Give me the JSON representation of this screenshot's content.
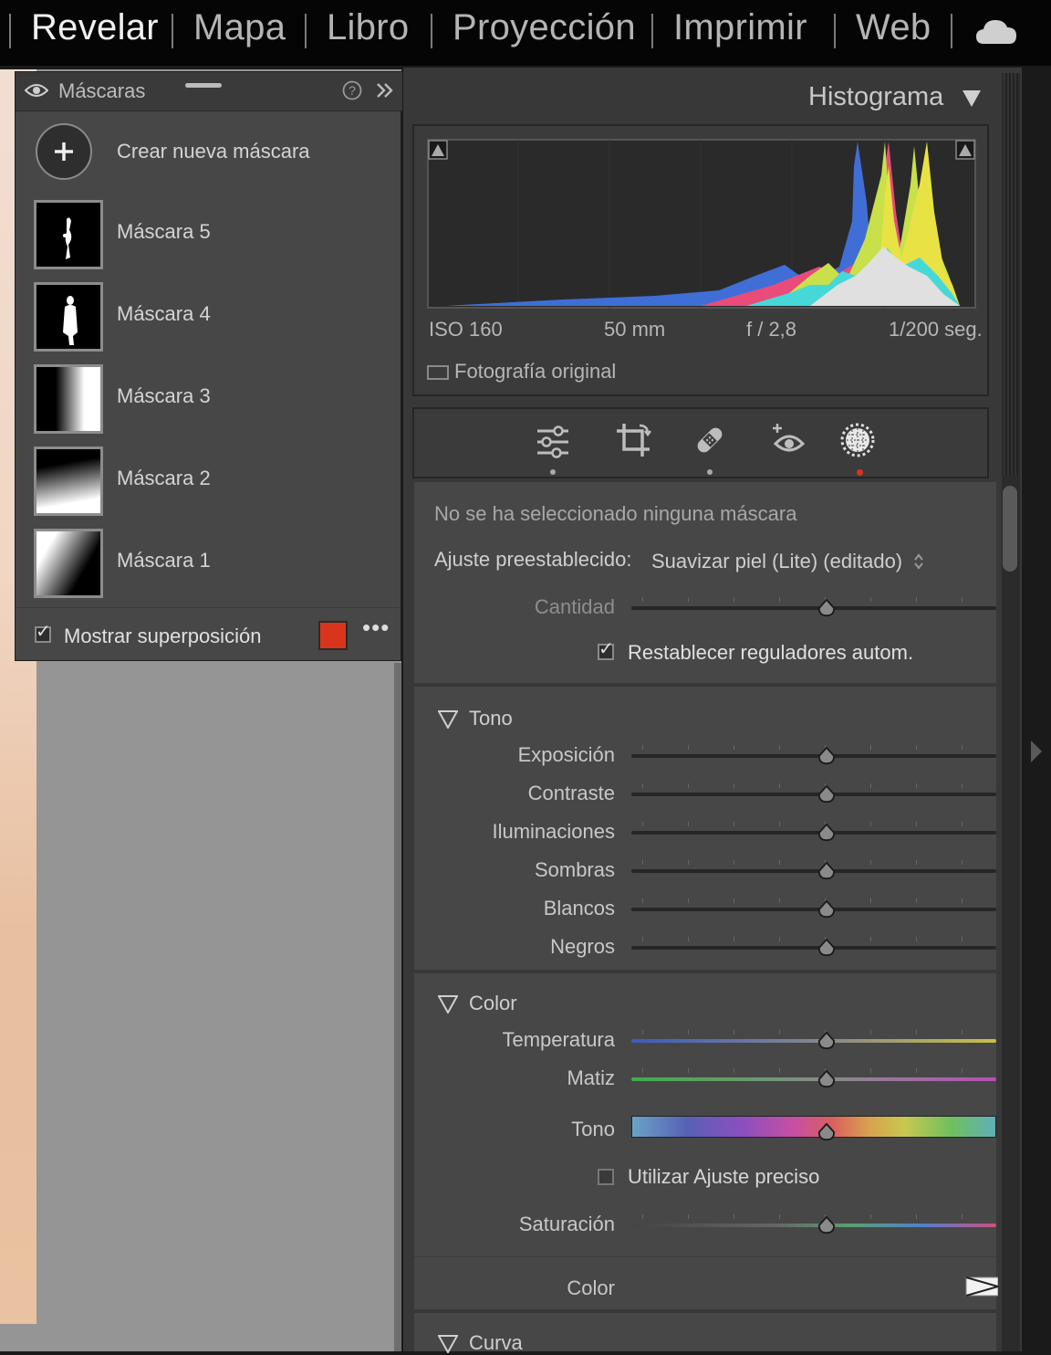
{
  "modules": {
    "items": [
      "Revelar",
      "Mapa",
      "Libro",
      "Proyección",
      "Imprimir",
      "Web"
    ],
    "active": "Revelar"
  },
  "masks_panel": {
    "title": "Máscaras",
    "create_label": "Crear nueva máscara",
    "masks": [
      "Máscara 5",
      "Máscara 4",
      "Máscara 3",
      "Máscara 2",
      "Máscara 1"
    ],
    "show_overlay_label": "Mostrar superposición",
    "show_overlay_checked": true,
    "overlay_color": "#d9341c"
  },
  "histogram": {
    "title": "Histograma",
    "iso": "ISO 160",
    "focal": "50 mm",
    "aperture": "f / 2,8",
    "shutter": "1/200 seg.",
    "original_photo_label": "Fotografía original"
  },
  "tools": [
    "edit-sliders-icon",
    "crop-icon",
    "healing-icon",
    "red-eye-icon",
    "masking-icon"
  ],
  "mask_settings": {
    "no_mask_text": "No se ha seleccionado ninguna máscara",
    "preset_label": "Ajuste preestablecido:",
    "preset_value": "Suavizar piel (Lite) (editado)",
    "amount_label": "Cantidad",
    "reset_label": "Restablecer reguladores autom.",
    "reset_checked": true
  },
  "tone": {
    "title": "Tono",
    "sliders": [
      "Exposición",
      "Contraste",
      "Iluminaciones",
      "Sombras",
      "Blancos",
      "Negros"
    ]
  },
  "color": {
    "title": "Color",
    "temp_label": "Temperatura",
    "tint_label": "Matiz",
    "hue_label": "Tono",
    "fine_adjust_label": "Utilizar Ajuste preciso",
    "fine_adjust_checked": false,
    "saturation_label": "Saturación",
    "color_label": "Color"
  },
  "curve": {
    "title": "Curva"
  },
  "colors": {
    "accent_red": "#d9341c",
    "panel_bg": "#474747"
  }
}
